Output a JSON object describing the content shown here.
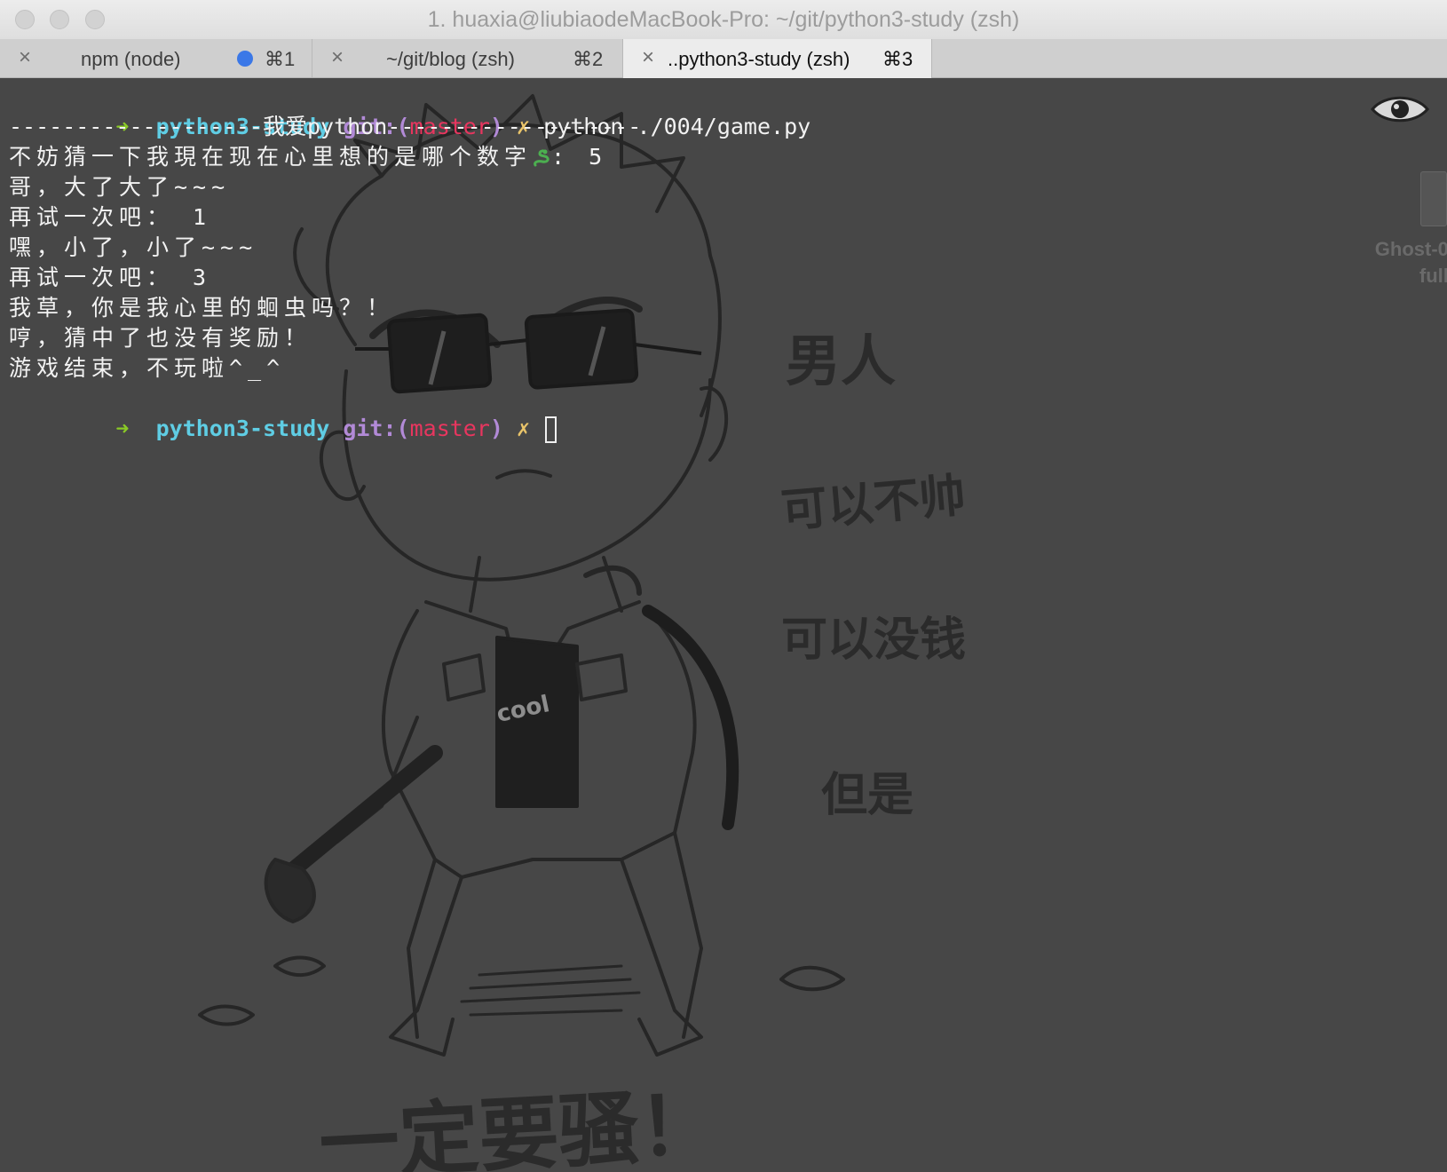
{
  "window": {
    "title": "1. huaxia@liubiaodeMacBook-Pro: ~/git/python3-study (zsh)"
  },
  "tabs": [
    {
      "label": "npm (node)",
      "shortcut": "⌘1",
      "active": false,
      "has_activity_dot": true
    },
    {
      "label": "~/git/blog (zsh)",
      "shortcut": "⌘2",
      "active": false
    },
    {
      "label": "..python3-study (zsh)",
      "shortcut": "⌘3",
      "active": true
    }
  ],
  "icons": {
    "close": "×",
    "prompt_arrow": "➜",
    "dirty_mark": "✗"
  },
  "prompt": {
    "dir": "python3-study",
    "git_prefix": "git:(",
    "branch": "master",
    "git_suffix": ")"
  },
  "command": "python ./004/game.py",
  "output": [
    "-------------------我爱python-------------------",
    "不妨猜一下我現在现在心里想的是哪个数字",
    ": 5",
    "哥，大了大了~~~",
    "再试一次吧： 1",
    "嘿，小了，小了~~~",
    "再试一次吧： 3",
    "我草，你是我心里的蛔虫吗？！",
    "哼，猜中了也没有奖励！",
    "游戏结束，不玩啦^_^"
  ],
  "background_art": {
    "shirt_text": "cool",
    "caption_lines": [
      "男人",
      "可以不帅",
      "可以没钱",
      "但是",
      "一定要骚！"
    ]
  },
  "desktop_overlay": {
    "file_name_line1": "Ghost-0.",
    "file_name_line2": "full."
  },
  "colors": {
    "arrow": "#8ac926",
    "dir": "#5fcde4",
    "git": "#b28ad7",
    "branch": "#e8365f",
    "dirty": "#e9c46a",
    "background": "#474747"
  }
}
